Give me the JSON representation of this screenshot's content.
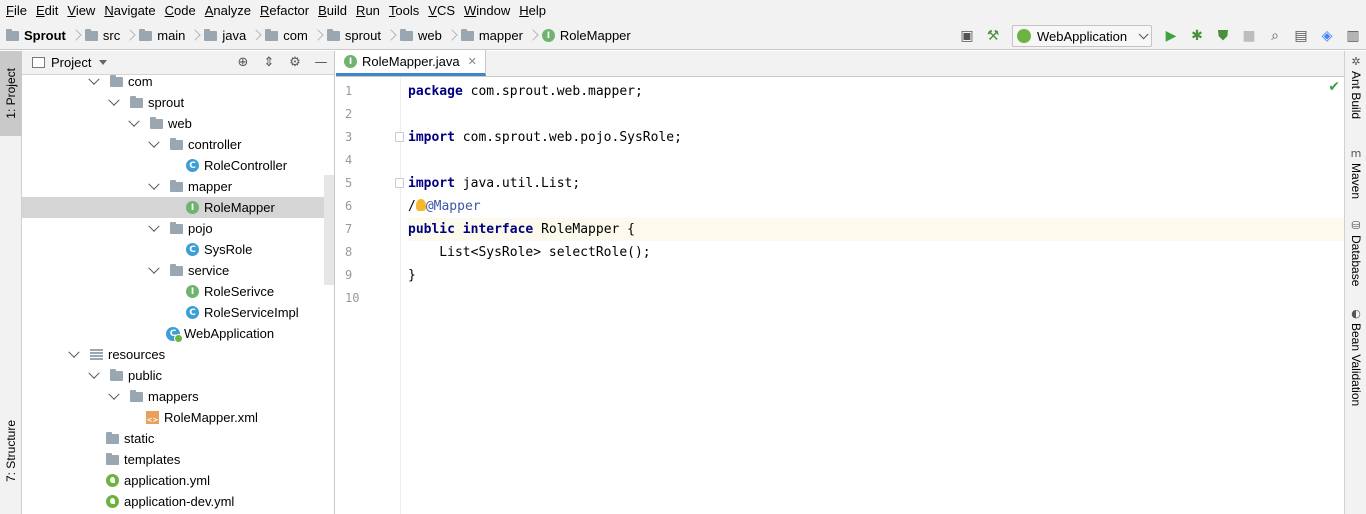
{
  "menu": [
    "File",
    "Edit",
    "View",
    "Navigate",
    "Code",
    "Analyze",
    "Refactor",
    "Build",
    "Run",
    "Tools",
    "VCS",
    "Window",
    "Help"
  ],
  "breadcrumb": {
    "project": "Sprout",
    "folders": [
      "src",
      "main",
      "java",
      "com",
      "sprout",
      "web",
      "mapper"
    ],
    "file": "RoleMapper",
    "file_icon": "I"
  },
  "run_config": "WebApplication",
  "toolbar_icons": [
    "layout-icon",
    "hammer-icon",
    "run-icon",
    "debug-icon",
    "coverage-icon",
    "stop-icon",
    "search-icon",
    "project-structure-icon",
    "translate-icon",
    "sdk-icon"
  ],
  "left_tabs": {
    "project": "1: Project",
    "structure": "7: Structure"
  },
  "right_tabs": [
    "Ant Build",
    "Maven",
    "Database",
    "Bean Validation"
  ],
  "project_panel": {
    "title": "Project",
    "tree": [
      {
        "label": "com",
        "indent": 0,
        "type": "folder",
        "expanded": true
      },
      {
        "label": "sprout",
        "indent": 1,
        "type": "folder",
        "expanded": true
      },
      {
        "label": "web",
        "indent": 2,
        "type": "folder",
        "expanded": true
      },
      {
        "label": "controller",
        "indent": 3,
        "type": "folder",
        "expanded": true
      },
      {
        "label": "RoleController",
        "indent": 4,
        "type": "class"
      },
      {
        "label": "mapper",
        "indent": 3,
        "type": "folder",
        "expanded": true
      },
      {
        "label": "RoleMapper",
        "indent": 4,
        "type": "interface",
        "selected": true
      },
      {
        "label": "pojo",
        "indent": 3,
        "type": "folder",
        "expanded": true
      },
      {
        "label": "SysRole",
        "indent": 4,
        "type": "class"
      },
      {
        "label": "service",
        "indent": 3,
        "type": "folder",
        "expanded": true
      },
      {
        "label": "RoleSerivce",
        "indent": 4,
        "type": "interface"
      },
      {
        "label": "RoleServiceImpl",
        "indent": 4,
        "type": "class"
      },
      {
        "label": "WebApplication",
        "indent": 3,
        "type": "app"
      },
      {
        "label": "resources",
        "indent": -1,
        "type": "resources",
        "expanded": true
      },
      {
        "label": "public",
        "indent": 0,
        "type": "folder",
        "expanded": true
      },
      {
        "label": "mappers",
        "indent": 1,
        "type": "folder",
        "expanded": true
      },
      {
        "label": "RoleMapper.xml",
        "indent": 2,
        "type": "xml"
      },
      {
        "label": "static",
        "indent": 0,
        "type": "folder",
        "leaf": true
      },
      {
        "label": "templates",
        "indent": 0,
        "type": "folder",
        "leaf": true
      },
      {
        "label": "application.yml",
        "indent": 0,
        "type": "yml"
      },
      {
        "label": "application-dev.yml",
        "indent": 0,
        "type": "yml"
      }
    ]
  },
  "editor": {
    "tab": "RoleMapper.java",
    "lines": [
      {
        "n": "1",
        "tokens": [
          {
            "t": "package",
            "c": "kw"
          },
          {
            "t": " com.sprout.web.mapper;",
            "c": "pl"
          }
        ]
      },
      {
        "n": "2",
        "tokens": []
      },
      {
        "n": "3",
        "tokens": [
          {
            "t": "import",
            "c": "kw"
          },
          {
            "t": " com.sprout.web.pojo.SysRole;",
            "c": "pl"
          }
        ],
        "fold": true
      },
      {
        "n": "4",
        "tokens": []
      },
      {
        "n": "5",
        "tokens": [
          {
            "t": "import",
            "c": "kw"
          },
          {
            "t": " java.util.List;",
            "c": "pl"
          }
        ],
        "fold": true
      },
      {
        "n": "6",
        "tokens": [
          {
            "t": "/",
            "c": "pl"
          },
          {
            "t": "BULB",
            "c": "bulb"
          },
          {
            "t": "@Mapper",
            "c": "ann2"
          }
        ]
      },
      {
        "n": "7",
        "tokens": [
          {
            "t": "public",
            "c": "kw"
          },
          {
            "t": " ",
            "c": "pl"
          },
          {
            "t": "interface",
            "c": "kw"
          },
          {
            "t": " RoleMapper {",
            "c": "pl"
          }
        ],
        "current": true
      },
      {
        "n": "8",
        "tokens": [
          {
            "t": "    List<SysRole> selectRole();",
            "c": "pl"
          }
        ]
      },
      {
        "n": "9",
        "tokens": [
          {
            "t": "}",
            "c": "pl"
          }
        ]
      },
      {
        "n": "10",
        "tokens": []
      }
    ]
  }
}
